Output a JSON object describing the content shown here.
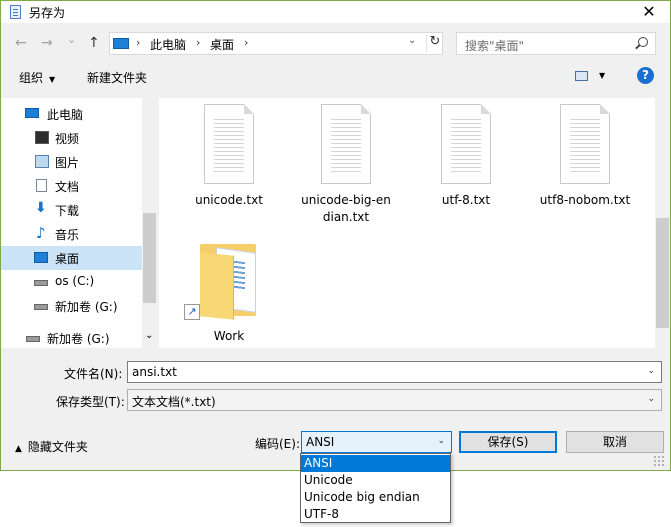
{
  "window": {
    "title": "另存为",
    "close_glyph": "✕"
  },
  "navbar": {
    "back_glyph": "←",
    "forward_glyph": "→",
    "recent_glyph": "⌄",
    "up_glyph": "↑",
    "breadcrumbs": [
      "此电脑",
      "桌面"
    ],
    "separator": "›",
    "dropdown_glyph": "⌄",
    "refresh_glyph": "↻",
    "search_placeholder": "搜索\"桌面\""
  },
  "toolbar": {
    "organize_label": "组织",
    "organize_caret": "▼",
    "new_folder_label": "新建文件夹",
    "view_caret": "▼",
    "help_label": "?"
  },
  "nav_pane": {
    "items": [
      {
        "label": "此电脑",
        "icon": "computer-icon"
      },
      {
        "label": "视频",
        "icon": "video-icon"
      },
      {
        "label": "图片",
        "icon": "picture-icon"
      },
      {
        "label": "文档",
        "icon": "document-icon"
      },
      {
        "label": "下载",
        "icon": "download-icon"
      },
      {
        "label": "音乐",
        "icon": "music-icon"
      },
      {
        "label": "桌面",
        "icon": "desktop-icon",
        "selected": true
      },
      {
        "label": "os (C:)",
        "icon": "drive-icon"
      },
      {
        "label": "新加卷 (G:)",
        "icon": "drive-icon"
      },
      {
        "label": "新加卷 (G:)",
        "icon": "drive-icon"
      }
    ],
    "scroll_down_glyph": "⌄"
  },
  "files": [
    {
      "name": "unicode.txt",
      "icon": "text-file-icon"
    },
    {
      "name": "unicode-big-en dian.txt",
      "line1": "unicode-big-en",
      "line2": "dian.txt",
      "icon": "text-file-icon"
    },
    {
      "name": "utf-8.txt",
      "icon": "text-file-icon"
    },
    {
      "name": "utf8-nobom.txt",
      "icon": "text-file-icon"
    },
    {
      "name": "Work",
      "icon": "folder-shortcut-icon"
    }
  ],
  "form": {
    "filename_label": "文件名(N):",
    "filename_value": "ansi.txt",
    "filetype_label": "保存类型(T):",
    "filetype_value": "文本文档(*.txt)",
    "field_caret": "⌄",
    "hide_folders_caret": "▲",
    "hide_folders_label": "隐藏文件夹",
    "encoding_label": "编码(E):",
    "encoding_value": "ANSI",
    "encoding_caret": "⌄",
    "save_label": "保存(S)",
    "cancel_label": "取消"
  },
  "encoding_options": [
    "ANSI",
    "Unicode",
    "Unicode big endian",
    "UTF-8"
  ],
  "encoding_selected": "ANSI",
  "colors": {
    "accent": "#0078d7",
    "selection": "#cce4f7",
    "folder": "#f5cd69"
  }
}
